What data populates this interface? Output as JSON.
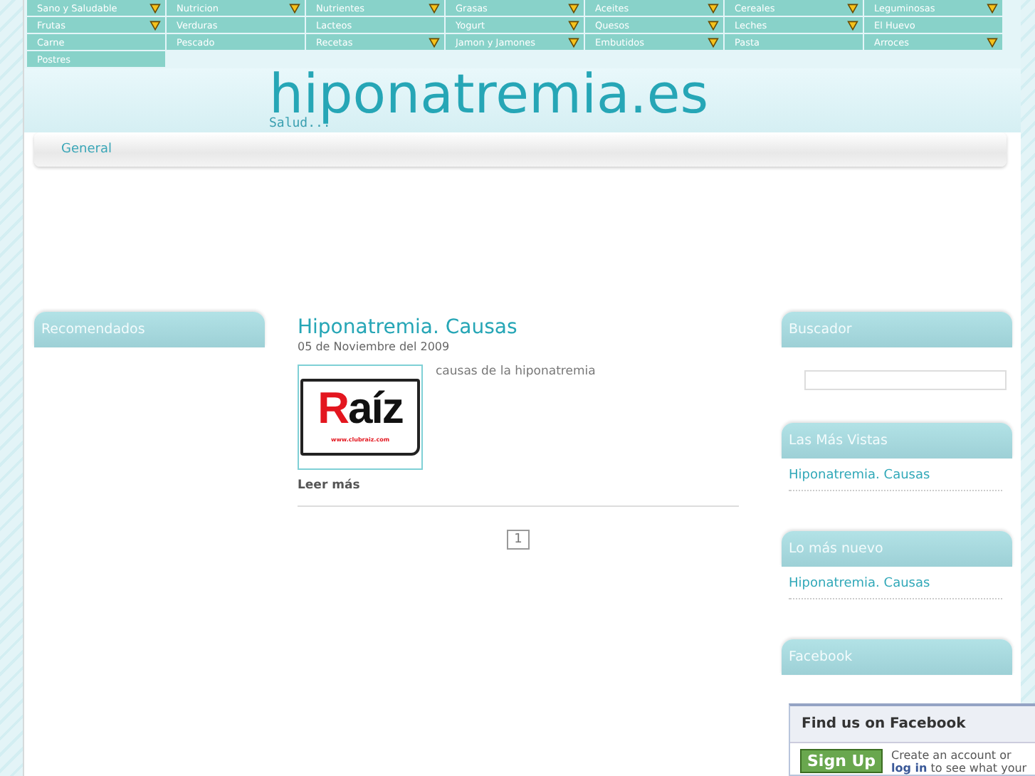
{
  "menu": [
    {
      "label": "Sano y Saludable",
      "submenu": true
    },
    {
      "label": "Nutricion",
      "submenu": true
    },
    {
      "label": "Nutrientes",
      "submenu": true
    },
    {
      "label": "Grasas",
      "submenu": true
    },
    {
      "label": "Aceites",
      "submenu": true
    },
    {
      "label": "Cereales",
      "submenu": true
    },
    {
      "label": "Leguminosas",
      "submenu": true
    },
    {
      "label": "Frutas",
      "submenu": true
    },
    {
      "label": "Verduras",
      "submenu": false
    },
    {
      "label": "Lacteos",
      "submenu": false
    },
    {
      "label": "Yogurt",
      "submenu": true
    },
    {
      "label": "Quesos",
      "submenu": true
    },
    {
      "label": "Leches",
      "submenu": true
    },
    {
      "label": "El Huevo",
      "submenu": false
    },
    {
      "label": "Carne",
      "submenu": false
    },
    {
      "label": "Pescado",
      "submenu": false
    },
    {
      "label": "Recetas",
      "submenu": true
    },
    {
      "label": "Jamon y Jamones",
      "submenu": true
    },
    {
      "label": "Embutidos",
      "submenu": true
    },
    {
      "label": "Pasta",
      "submenu": false
    },
    {
      "label": "Arroces",
      "submenu": true
    },
    {
      "label": "Postres",
      "submenu": false
    }
  ],
  "site": {
    "title": "hiponatremia.es",
    "tagline": "Salud..."
  },
  "nav": [
    {
      "label": "General"
    }
  ],
  "left_sidebar": {
    "title": "Recomendados"
  },
  "article": {
    "title": "Hiponatremia. Causas",
    "date": "05 de Noviembre del 2009",
    "excerpt": "causas de la hiponatremia",
    "read_more": "Leer más",
    "image": {
      "logo_text": "Raíz",
      "url_text": "www.clubraiz.com"
    }
  },
  "pagination": [
    {
      "label": "1"
    }
  ],
  "right_sidebar": [
    {
      "kind": "search",
      "title": "Buscador"
    },
    {
      "kind": "links",
      "title": "Las Más Vistas",
      "links": [
        "Hiponatremia. Causas"
      ]
    },
    {
      "kind": "links",
      "title": "Lo más nuevo",
      "links": [
        "Hiponatremia. Causas"
      ]
    },
    {
      "kind": "title",
      "title": "Facebook"
    }
  ],
  "facebook": {
    "title": "Find us on Facebook",
    "button": "Sign Up",
    "text_before": "Create an account or",
    "link": "log in",
    "text_after": "to see what your"
  }
}
